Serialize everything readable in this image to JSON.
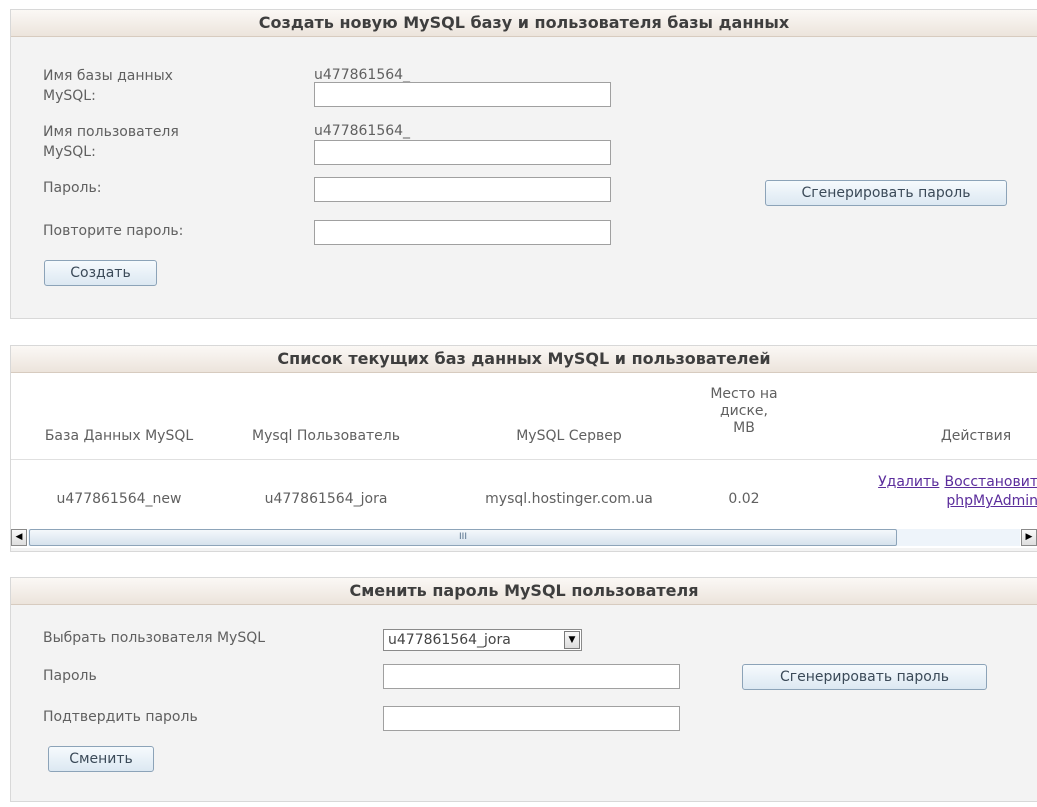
{
  "create_section": {
    "title": "Создать новую MySQL базу и пользователя базы данных",
    "db_name_label": "Имя базы данных MySQL:",
    "db_prefix": "u477861564_",
    "db_name_value": "",
    "user_name_label": "Имя пользователя MySQL:",
    "user_prefix": "u477861564_",
    "user_name_value": "",
    "password_label": "Пароль:",
    "password_value": "",
    "repeat_password_label": "Повторите пароль:",
    "repeat_password_value": "",
    "generate_button": "Сгенерировать пароль",
    "create_button": "Создать"
  },
  "list_section": {
    "title": "Список текущих баз данных MySQL и пользователей",
    "columns": [
      "База Данных MySQL",
      "Mysql Пользователь",
      "MySQL Сервер",
      "Место на диске, MB",
      "Действия"
    ],
    "rows": [
      {
        "database": "u477861564_new",
        "user": "u477861564_jora",
        "server": "mysql.hostinger.com.ua",
        "disk_mb": "0.02",
        "actions": [
          "Удалить",
          "Восстановит",
          "phpMyAdmin"
        ]
      }
    ],
    "scrollbar_grip": "III"
  },
  "change_section": {
    "title": "Сменить пароль MySQL пользователя",
    "select_user_label": "Выбрать пользователя MySQL",
    "selected_user": "u477861564_jora",
    "password_label": "Пароль",
    "password_value": "",
    "confirm_label": "Подтвердить пароль",
    "confirm_value": "",
    "generate_button": "Сгенерировать пароль",
    "change_button": "Сменить"
  }
}
